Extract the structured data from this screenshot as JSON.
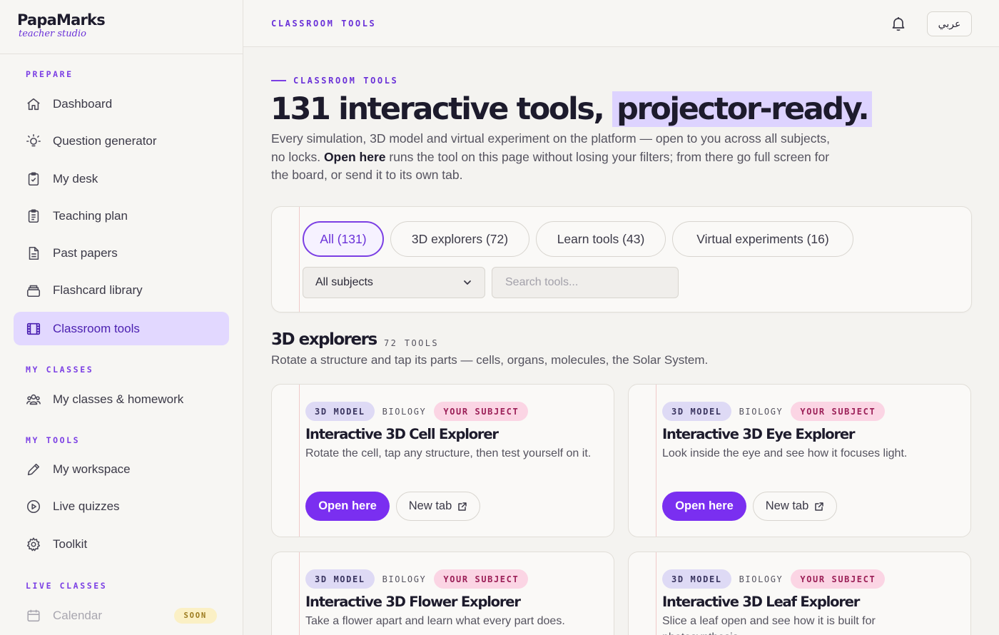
{
  "brand": {
    "name": "PapaMarks",
    "sub": "teacher studio"
  },
  "sidebar": {
    "sections": [
      {
        "label": "PREPARE"
      },
      {
        "label": "MY CLASSES"
      },
      {
        "label": "MY TOOLS"
      },
      {
        "label": "LIVE CLASSES"
      }
    ],
    "items": [
      {
        "label": "Dashboard",
        "icon": "home-icon"
      },
      {
        "label": "Question generator",
        "icon": "lightbulb-icon"
      },
      {
        "label": "My desk",
        "icon": "clipboard-check-icon"
      },
      {
        "label": "Teaching plan",
        "icon": "clipboard-list-icon"
      },
      {
        "label": "Past papers",
        "icon": "document-icon"
      },
      {
        "label": "Flashcard library",
        "icon": "card-stack-icon"
      },
      {
        "label": "Classroom tools",
        "icon": "film-icon",
        "active": true
      },
      {
        "label": "My classes & homework",
        "icon": "users-icon"
      },
      {
        "label": "My workspace",
        "icon": "pencil-icon"
      },
      {
        "label": "Live quizzes",
        "icon": "play-circle-icon"
      },
      {
        "label": "Toolkit",
        "icon": "gear-icon"
      },
      {
        "label": "Calendar",
        "icon": "calendar-icon",
        "badge": "SOON"
      }
    ]
  },
  "topbar": {
    "title": "CLASSROOM TOOLS",
    "lang": "عربي"
  },
  "hero": {
    "eyebrow": "CLASSROOM TOOLS",
    "headline": "131 interactive tools,",
    "headline_highlight": "projector-ready.",
    "intro_a": "Every simulation, 3D model and virtual experiment on the platform — open to you across all subjects, no locks. ",
    "intro_bold": "Open here",
    "intro_b": " runs the tool on this page without losing your filters; from there go full screen for the board, or send it to its own tab."
  },
  "filters": {
    "tabs": [
      "All (131)",
      "3D explorers (72)",
      "Learn tools (43)",
      "Virtual experiments (16)"
    ],
    "subject": "All subjects",
    "search_placeholder": "Search tools..."
  },
  "section": {
    "title": "3D explorers",
    "count": "72 TOOLS",
    "desc": "Rotate a structure and tap its parts — cells, organs, molecules, the Solar System."
  },
  "cards": [
    {
      "tag_type": "3D MODEL",
      "tag_subject": "BIOLOGY",
      "tag_yours": "YOUR SUBJECT",
      "title": "Interactive 3D Cell Explorer",
      "desc": "Rotate the cell, tap any structure, then test yourself on it.",
      "open": "Open here",
      "newtab": "New tab"
    },
    {
      "tag_type": "3D MODEL",
      "tag_subject": "BIOLOGY",
      "tag_yours": "YOUR SUBJECT",
      "title": "Interactive 3D Eye Explorer",
      "desc": "Look inside the eye and see how it focuses light.",
      "open": "Open here",
      "newtab": "New tab"
    },
    {
      "tag_type": "3D MODEL",
      "tag_subject": "BIOLOGY",
      "tag_yours": "YOUR SUBJECT",
      "title": "Interactive 3D Flower Explorer",
      "desc": "Take a flower apart and learn what every part does."
    },
    {
      "tag_type": "3D MODEL",
      "tag_subject": "BIOLOGY",
      "tag_yours": "YOUR SUBJECT",
      "title": "Interactive 3D Leaf Explorer",
      "desc": "Slice a leaf open and see how it is built for photosynthesis."
    }
  ]
}
